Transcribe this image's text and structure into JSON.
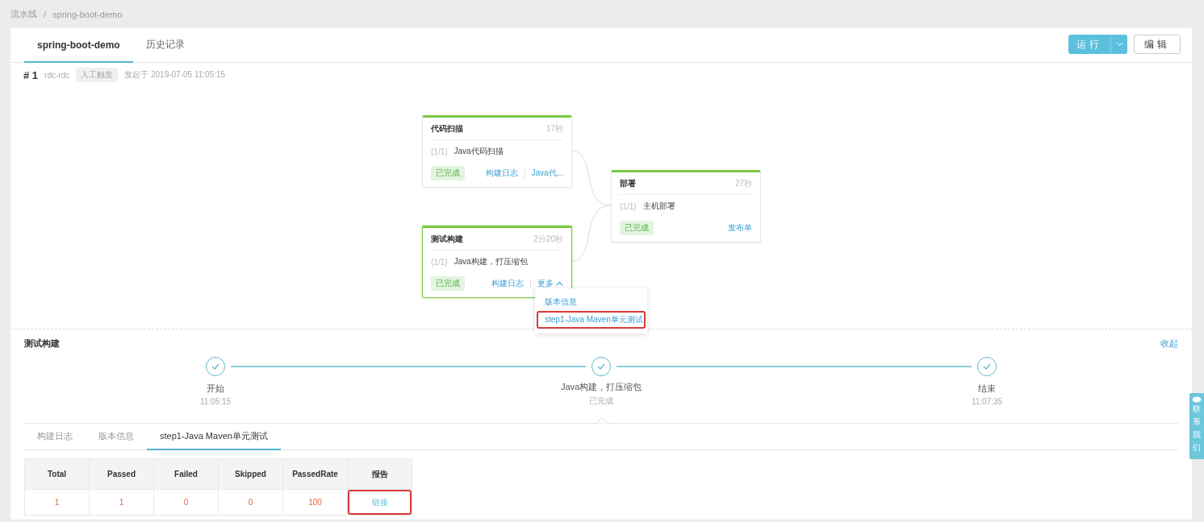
{
  "breadcrumb": {
    "items": [
      "流水线",
      "spring-boot-demo"
    ],
    "separator": "/"
  },
  "tabs": [
    {
      "label": "spring-boot-demo",
      "selected": true
    },
    {
      "label": "历史记录",
      "selected": false
    }
  ],
  "actions": {
    "run": "运行",
    "edit": "编辑"
  },
  "run": {
    "number": "# 1",
    "user": "rdc-rdc",
    "trigger": "人工触发",
    "started": "发起于 2019-07-05 11:05:15"
  },
  "stages": [
    {
      "title": "代码扫描",
      "duration": "17秒",
      "task_index": "(1/1)",
      "task": "Java代码扫描",
      "status": "已完成",
      "selected": false,
      "links": [
        "构建日志",
        "Java代..."
      ]
    },
    {
      "title": "部署",
      "duration": "27秒",
      "task_index": "(1/1)",
      "task": "主机部署",
      "status": "已完成",
      "selected": false,
      "links": [
        "发布单"
      ]
    },
    {
      "title": "测试构建",
      "duration": "2分20秒",
      "task_index": "(1/1)",
      "task": "Java构建，打压缩包",
      "status": "已完成",
      "selected": true,
      "links": [
        "构建日志"
      ],
      "more": {
        "label": "更多",
        "expanded": true
      }
    }
  ],
  "dropdown": [
    {
      "label": "版本信息",
      "highlighted": false
    },
    {
      "label": "step1-Java Maven单元测试",
      "highlighted": true
    }
  ],
  "detail": {
    "title": "测试构建",
    "collapse": "收起",
    "steps": [
      {
        "name": "开始",
        "sub": "11:05:15"
      },
      {
        "name": "Java构建，打压缩包",
        "sub": "已完成"
      },
      {
        "name": "结束",
        "sub": "11:07:35"
      }
    ],
    "tabs": [
      {
        "label": "构建日志",
        "selected": false
      },
      {
        "label": "版本信息",
        "selected": false
      },
      {
        "label": "step1-Java Maven单元测试",
        "selected": true
      }
    ],
    "table": {
      "columns": [
        "Total",
        "Passed",
        "Failed",
        "Skipped",
        "PassedRate",
        "报告"
      ],
      "rows": [
        {
          "cells": [
            "1",
            "1",
            "0",
            "0",
            "100"
          ],
          "link": "链接",
          "highlighted": true
        }
      ]
    }
  },
  "contact_tab": "联系我们"
}
